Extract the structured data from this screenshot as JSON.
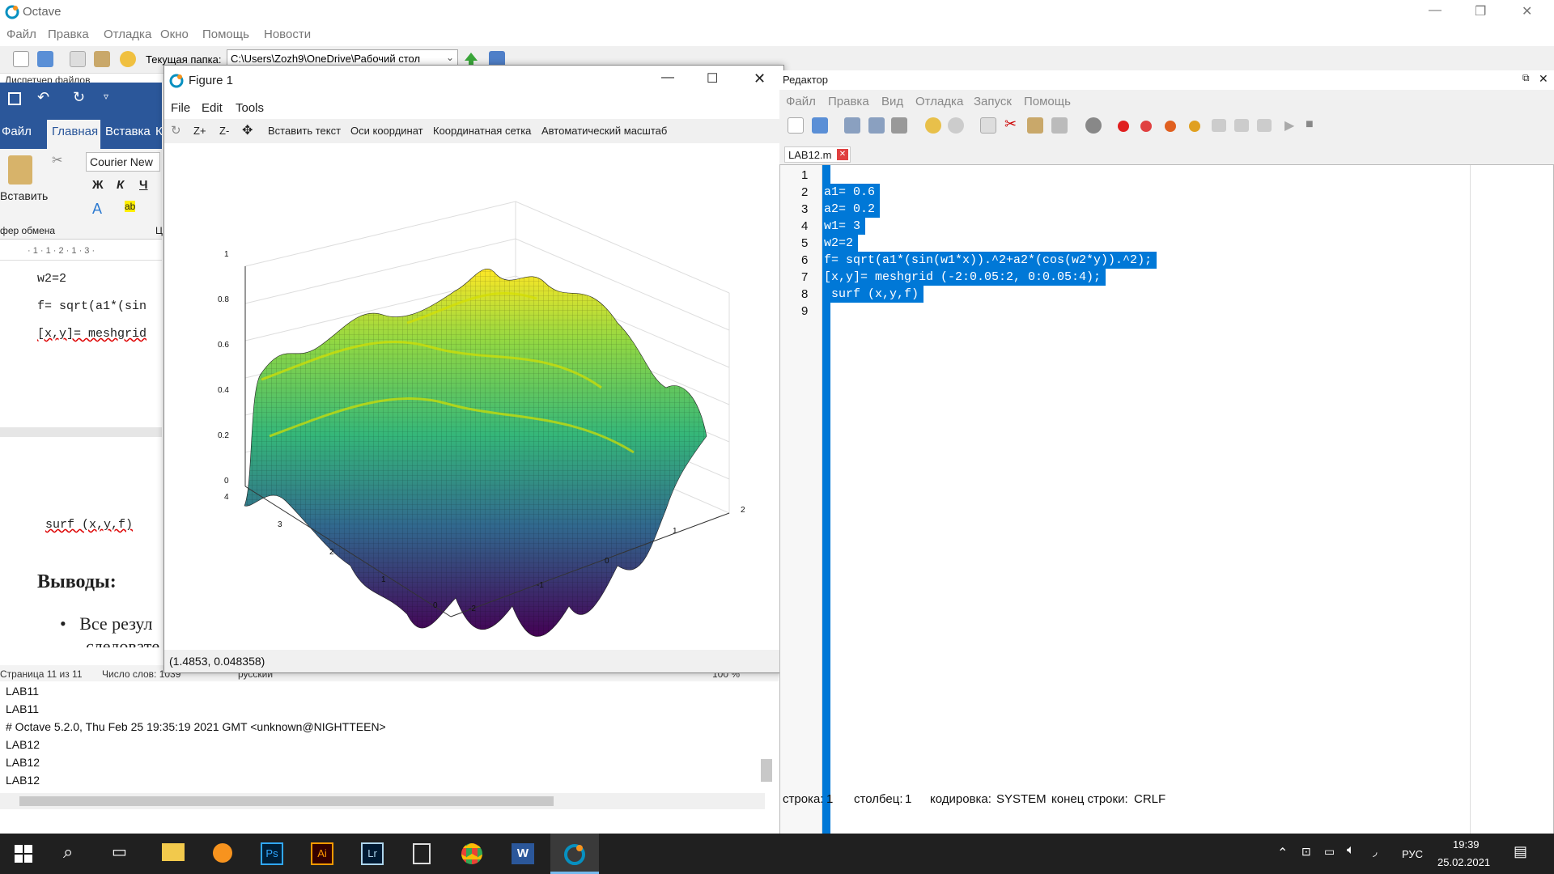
{
  "app": {
    "title": "Octave",
    "menu": [
      "Файл",
      "Правка",
      "Отладка",
      "Окно",
      "Помощь",
      "Новости"
    ],
    "path_label": "Текущая папка:",
    "path_value": "C:\\Users\\Zozh9\\OneDrive\\Рабочий стол",
    "file_manager_label": "Диспетчер файлов"
  },
  "word": {
    "tab_file": "Файл",
    "tab_home": "Главная",
    "tab_insert": "Вставка",
    "tab_k": "К",
    "paste_label": "Вставить",
    "clipboard_label": "фер обмена",
    "font_name": "Courier New",
    "bold": "Ж",
    "italic": "К",
    "underline": "Ч",
    "ruler_text": "· 1 · 1 · 2 · 1 · 3 ·",
    "ruler_c": "Ц",
    "doc_lines": [
      "w2=2",
      "f= sqrt(a1*(sin",
      "[x,y]= meshgrid"
    ],
    "doc_surf": "surf (x,y,f)",
    "heading": "Выводы:",
    "bullet": "Все резул",
    "bullet2": "следовате",
    "status_page": "Страница 11 из 11",
    "status_words": "Число слов: 1039",
    "status_lang": "русский",
    "zoom": "100 %"
  },
  "command_window": {
    "lines": [
      "LAB11",
      "LAB11",
      "# Octave 5.2.0, Thu Feb 25 19:35:19 2021 GMT <unknown@NIGHTTEEN>",
      "LAB12",
      "LAB12",
      "LAB12"
    ]
  },
  "figure": {
    "title": "Figure 1",
    "menu": [
      "File",
      "Edit",
      "Tools"
    ],
    "tools": [
      "Z+",
      "Z-",
      "Вставить текст",
      "Оси координат",
      "Координатная сетка",
      "Автоматический масштаб"
    ],
    "status": "(1.4853, 0.048358)",
    "z_ticks": [
      "0",
      "0.2",
      "0.4",
      "0.6",
      "0.8",
      "1"
    ],
    "y_ticks": [
      "0",
      "1",
      "2",
      "3",
      "4"
    ],
    "x_ticks": [
      "-2",
      "-1",
      "0",
      "1",
      "2"
    ]
  },
  "editor": {
    "title": "Редактор",
    "menu": [
      "Файл",
      "Правка",
      "Вид",
      "Отладка",
      "Запуск",
      "Помощь"
    ],
    "tab": "LAB12.m",
    "line_numbers": [
      "1",
      "2",
      "3",
      "4",
      "5",
      "6",
      "7",
      "8",
      "9"
    ],
    "code": [
      "",
      "a1= 0.6",
      "a2= 0.2",
      "w1= 3",
      "w2=2",
      "f= sqrt(a1*(sin(w1*x)).^2+a2*(cos(w2*y)).^2);",
      "[x,y]= meshgrid (-2:0.05:2, 0:0.05:4);",
      " surf (x,y,f)",
      ""
    ],
    "status_line_label": "строка:",
    "status_line": "1",
    "status_col_label": "столбец:",
    "status_col": "1",
    "status_enc_label": "кодировка:",
    "status_enc": "SYSTEM",
    "status_eol_label": "конец строки:",
    "status_eol": "CRLF"
  },
  "taskbar": {
    "lang": "РУС",
    "time": "19:39",
    "date": "25.02.2021"
  }
}
